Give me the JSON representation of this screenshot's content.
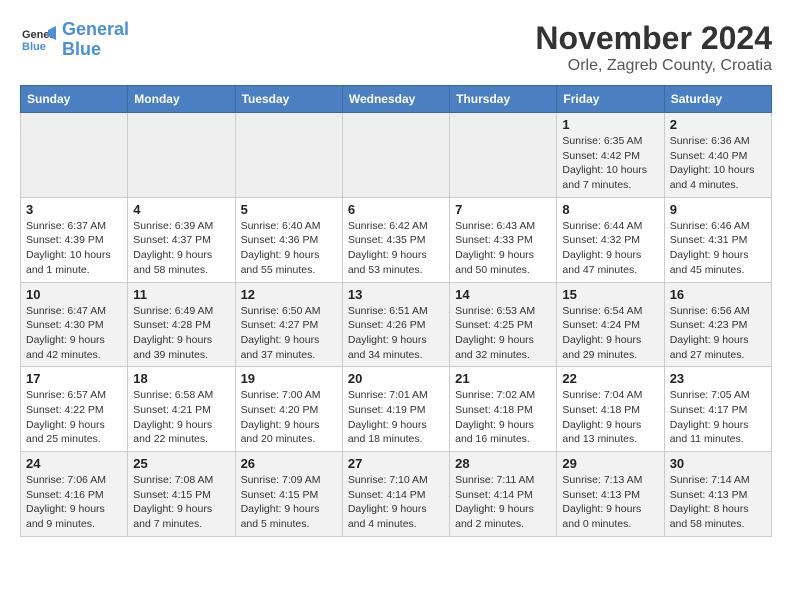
{
  "logo": {
    "name_part1": "General",
    "name_part2": "Blue"
  },
  "title": "November 2024",
  "location": "Orle, Zagreb County, Croatia",
  "days_of_week": [
    "Sunday",
    "Monday",
    "Tuesday",
    "Wednesday",
    "Thursday",
    "Friday",
    "Saturday"
  ],
  "weeks": [
    [
      {
        "day": "",
        "info": ""
      },
      {
        "day": "",
        "info": ""
      },
      {
        "day": "",
        "info": ""
      },
      {
        "day": "",
        "info": ""
      },
      {
        "day": "",
        "info": ""
      },
      {
        "day": "1",
        "info": "Sunrise: 6:35 AM\nSunset: 4:42 PM\nDaylight: 10 hours and 7 minutes."
      },
      {
        "day": "2",
        "info": "Sunrise: 6:36 AM\nSunset: 4:40 PM\nDaylight: 10 hours and 4 minutes."
      }
    ],
    [
      {
        "day": "3",
        "info": "Sunrise: 6:37 AM\nSunset: 4:39 PM\nDaylight: 10 hours and 1 minute."
      },
      {
        "day": "4",
        "info": "Sunrise: 6:39 AM\nSunset: 4:37 PM\nDaylight: 9 hours and 58 minutes."
      },
      {
        "day": "5",
        "info": "Sunrise: 6:40 AM\nSunset: 4:36 PM\nDaylight: 9 hours and 55 minutes."
      },
      {
        "day": "6",
        "info": "Sunrise: 6:42 AM\nSunset: 4:35 PM\nDaylight: 9 hours and 53 minutes."
      },
      {
        "day": "7",
        "info": "Sunrise: 6:43 AM\nSunset: 4:33 PM\nDaylight: 9 hours and 50 minutes."
      },
      {
        "day": "8",
        "info": "Sunrise: 6:44 AM\nSunset: 4:32 PM\nDaylight: 9 hours and 47 minutes."
      },
      {
        "day": "9",
        "info": "Sunrise: 6:46 AM\nSunset: 4:31 PM\nDaylight: 9 hours and 45 minutes."
      }
    ],
    [
      {
        "day": "10",
        "info": "Sunrise: 6:47 AM\nSunset: 4:30 PM\nDaylight: 9 hours and 42 minutes."
      },
      {
        "day": "11",
        "info": "Sunrise: 6:49 AM\nSunset: 4:28 PM\nDaylight: 9 hours and 39 minutes."
      },
      {
        "day": "12",
        "info": "Sunrise: 6:50 AM\nSunset: 4:27 PM\nDaylight: 9 hours and 37 minutes."
      },
      {
        "day": "13",
        "info": "Sunrise: 6:51 AM\nSunset: 4:26 PM\nDaylight: 9 hours and 34 minutes."
      },
      {
        "day": "14",
        "info": "Sunrise: 6:53 AM\nSunset: 4:25 PM\nDaylight: 9 hours and 32 minutes."
      },
      {
        "day": "15",
        "info": "Sunrise: 6:54 AM\nSunset: 4:24 PM\nDaylight: 9 hours and 29 minutes."
      },
      {
        "day": "16",
        "info": "Sunrise: 6:56 AM\nSunset: 4:23 PM\nDaylight: 9 hours and 27 minutes."
      }
    ],
    [
      {
        "day": "17",
        "info": "Sunrise: 6:57 AM\nSunset: 4:22 PM\nDaylight: 9 hours and 25 minutes."
      },
      {
        "day": "18",
        "info": "Sunrise: 6:58 AM\nSunset: 4:21 PM\nDaylight: 9 hours and 22 minutes."
      },
      {
        "day": "19",
        "info": "Sunrise: 7:00 AM\nSunset: 4:20 PM\nDaylight: 9 hours and 20 minutes."
      },
      {
        "day": "20",
        "info": "Sunrise: 7:01 AM\nSunset: 4:19 PM\nDaylight: 9 hours and 18 minutes."
      },
      {
        "day": "21",
        "info": "Sunrise: 7:02 AM\nSunset: 4:18 PM\nDaylight: 9 hours and 16 minutes."
      },
      {
        "day": "22",
        "info": "Sunrise: 7:04 AM\nSunset: 4:18 PM\nDaylight: 9 hours and 13 minutes."
      },
      {
        "day": "23",
        "info": "Sunrise: 7:05 AM\nSunset: 4:17 PM\nDaylight: 9 hours and 11 minutes."
      }
    ],
    [
      {
        "day": "24",
        "info": "Sunrise: 7:06 AM\nSunset: 4:16 PM\nDaylight: 9 hours and 9 minutes."
      },
      {
        "day": "25",
        "info": "Sunrise: 7:08 AM\nSunset: 4:15 PM\nDaylight: 9 hours and 7 minutes."
      },
      {
        "day": "26",
        "info": "Sunrise: 7:09 AM\nSunset: 4:15 PM\nDaylight: 9 hours and 5 minutes."
      },
      {
        "day": "27",
        "info": "Sunrise: 7:10 AM\nSunset: 4:14 PM\nDaylight: 9 hours and 4 minutes."
      },
      {
        "day": "28",
        "info": "Sunrise: 7:11 AM\nSunset: 4:14 PM\nDaylight: 9 hours and 2 minutes."
      },
      {
        "day": "29",
        "info": "Sunrise: 7:13 AM\nSunset: 4:13 PM\nDaylight: 9 hours and 0 minutes."
      },
      {
        "day": "30",
        "info": "Sunrise: 7:14 AM\nSunset: 4:13 PM\nDaylight: 8 hours and 58 minutes."
      }
    ]
  ]
}
